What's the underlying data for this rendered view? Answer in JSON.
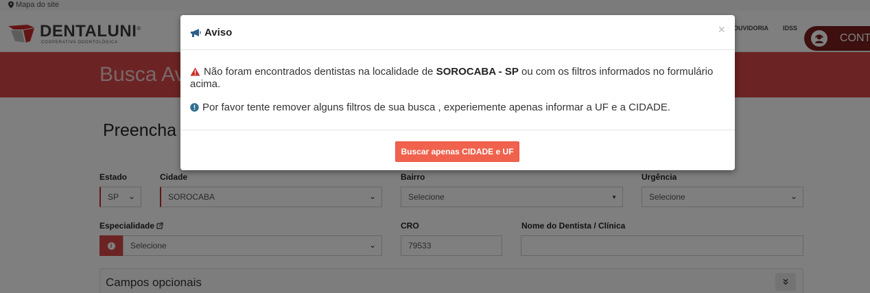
{
  "topbar": {
    "sitemap_label": "Mapa do site"
  },
  "header": {
    "logo_word_1": "DENTAL",
    "logo_word_2": "UNI",
    "logo_trademark": "®",
    "logo_subtitle": "COOPERATIVA ODONTOLÓGICA",
    "nav": [
      "OUVIDORIA",
      "IDSS"
    ],
    "contact_label": "CONTA"
  },
  "banner": {
    "title": "Busca Av"
  },
  "form": {
    "title": "Preencha",
    "estado": {
      "label": "Estado",
      "value": "SP"
    },
    "cidade": {
      "label": "Cidade",
      "value": "SOROCABA"
    },
    "bairro": {
      "label": "Bairro",
      "value": "Selecione"
    },
    "urgencia": {
      "label": "Urgência",
      "value": "Selecione"
    },
    "especialidade": {
      "label": "Especialidade",
      "value": "Selecione"
    },
    "cro": {
      "label": "CRO",
      "value": "79533"
    },
    "nome": {
      "label": "Nome do Dentista / Clínica",
      "value": ""
    },
    "optional_section": "Campos opcionais"
  },
  "modal": {
    "title": "Aviso",
    "close_symbol": "×",
    "warning_prefix": "Não foram encontrados dentistas na localidade de ",
    "warning_location": "SOROCABA - SP",
    "warning_suffix": " ou com os filtros informados no formulário acima.",
    "info_text": "Por favor tente remover alguns filtros de sua busca , experiemente apenas informar a UF e a CIDADE.",
    "button_label": "Buscar apenas CIDADE e UF"
  },
  "colors": {
    "brand_red": "#d94748",
    "dark_red": "#7a1f1f",
    "button_orange": "#f0624d",
    "warning_icon": "#c9302c",
    "info_icon": "#31708f"
  },
  "icons": [
    "map-marker-icon",
    "megaphone-icon",
    "warning-triangle-icon",
    "info-circle-icon",
    "close-icon",
    "chevron-down-icon",
    "external-link-icon",
    "double-chevron-down-icon"
  ]
}
